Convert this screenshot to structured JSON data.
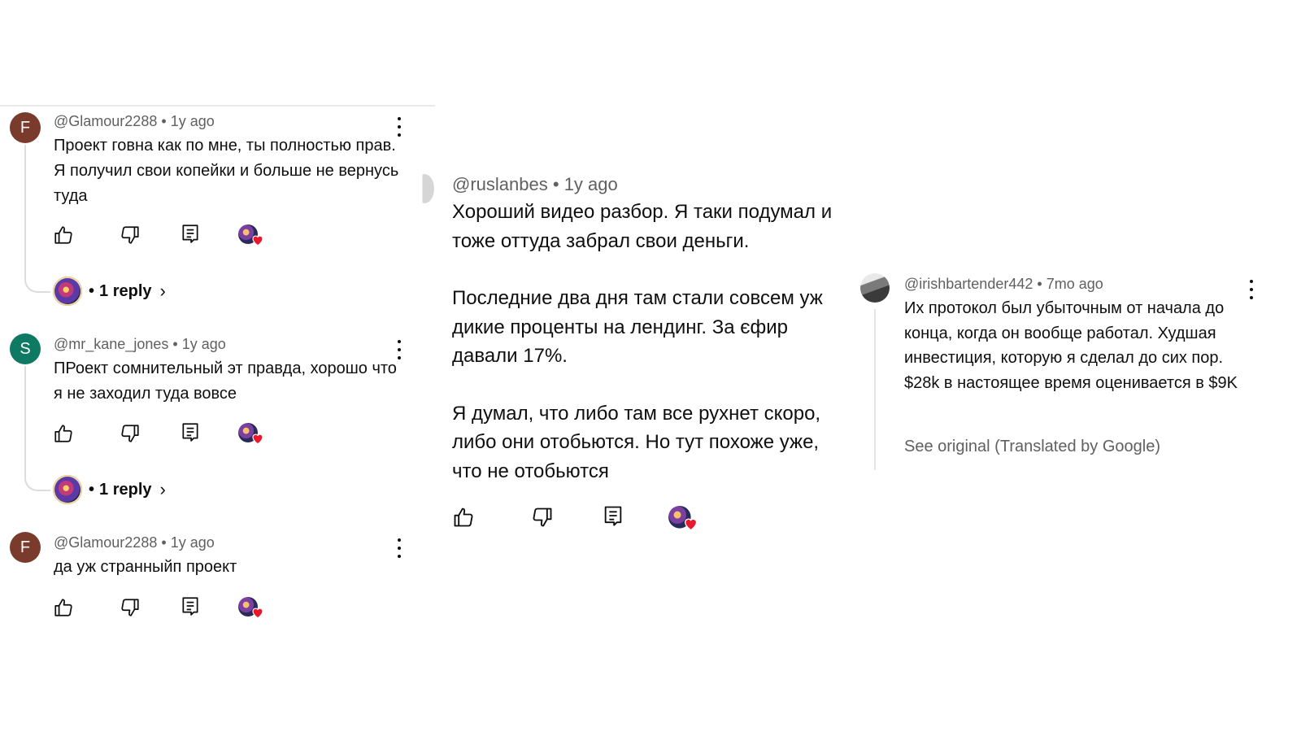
{
  "colors": {
    "avatar_f": "#7a3b2c",
    "avatar_s": "#0f7a64",
    "heart": "#e8192c",
    "meta": "#606060"
  },
  "left": {
    "comments": [
      {
        "avatar_letter": "F",
        "handle": "@Glamour2288",
        "time": "1y ago",
        "text": "Проект говна как по мне, ты полностью прав. Я получил свои копейки и больше не вернусь туда",
        "reply_label": "1 reply"
      },
      {
        "avatar_letter": "S",
        "handle": "@mr_kane_jones",
        "time": "1y ago",
        "text": "ПРоект сомнительный эт правда, хорошо что я не заходил туда вовсе",
        "reply_label": "1 reply"
      },
      {
        "avatar_letter": "F",
        "handle": "@Glamour2288",
        "time": "1y ago",
        "text": "да уж странныйп проект"
      }
    ],
    "separator": "•",
    "reply_bullet": "•",
    "reply_chevron": "›"
  },
  "middle": {
    "handle": "@ruslanbes",
    "time": "1y ago",
    "paragraphs": [
      "Хороший видео разбор. Я таки подумал и тоже оттуда забрал свои деньги.",
      "Последние два дня там стали совсем уж дикие проценты на лендинг. За єфир давали 17%.",
      "Я думал, что либо там все рухнет скоро, либо они отобьются. Но тут похоже уже, что не отобьются"
    ]
  },
  "right": {
    "handle": "@irishbartender442",
    "time": "7mo ago",
    "text": "Их протокол был убыточным от начала до конца, когда он вообще работал. Худшая инвестиция, которую я сделал до сих пор. $28k в настоящее время оценивается в $9K",
    "see_original": "See original (Translated by Google)"
  },
  "icons": [
    "thumbs-up-icon",
    "thumbs-down-icon",
    "reply-icon",
    "creator-heart-icon",
    "more-vert-icon",
    "chevron-right-icon"
  ]
}
